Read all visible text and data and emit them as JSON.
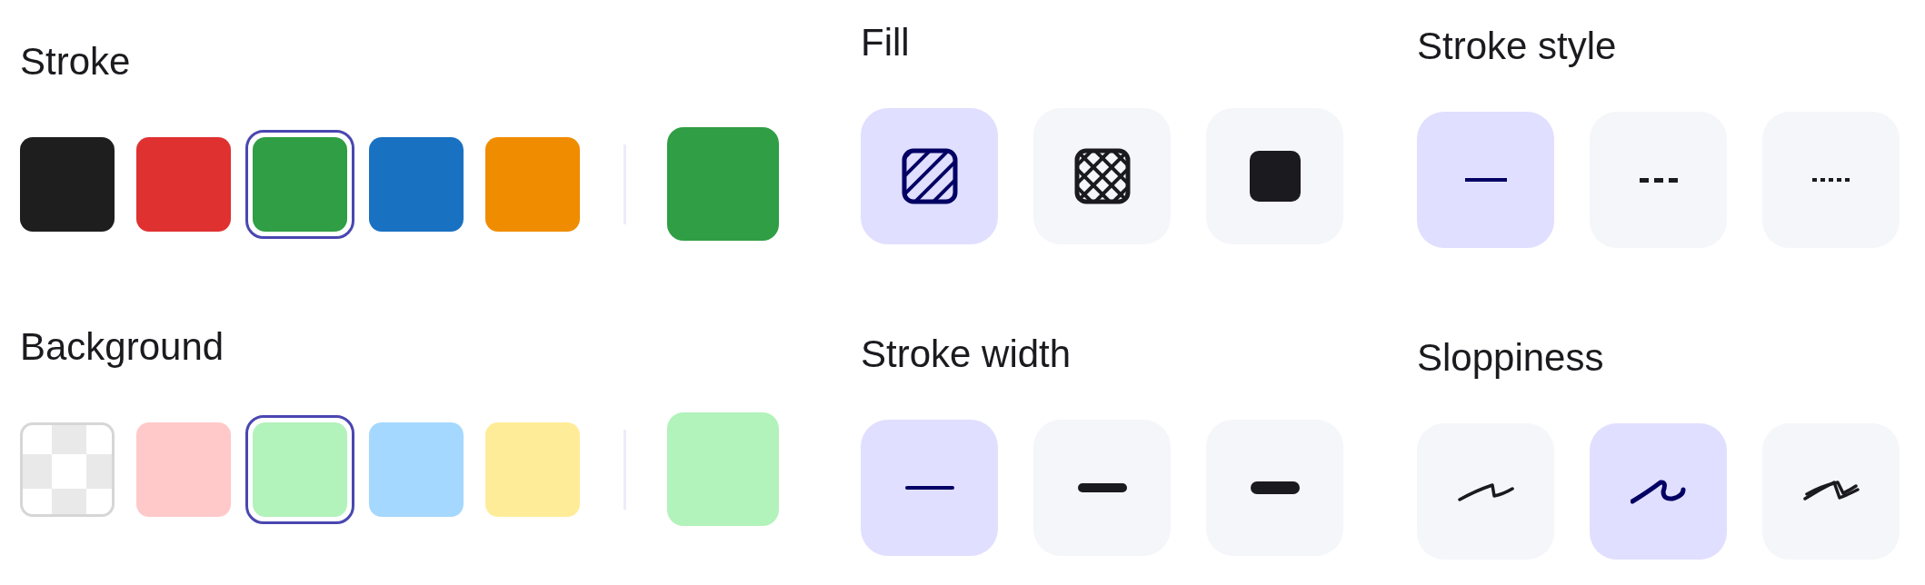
{
  "stroke": {
    "label": "Stroke",
    "swatches": [
      {
        "kind": "color",
        "color": "#1e1e1e",
        "selected": false
      },
      {
        "kind": "color",
        "color": "#e03131",
        "selected": false
      },
      {
        "kind": "color",
        "color": "#2f9e44",
        "selected": true
      },
      {
        "kind": "color",
        "color": "#1971c2",
        "selected": false
      },
      {
        "kind": "color",
        "color": "#f08c00",
        "selected": false
      }
    ],
    "current": {
      "color": "#2f9e44"
    }
  },
  "background": {
    "label": "Background",
    "swatches": [
      {
        "kind": "transparent",
        "selected": false
      },
      {
        "kind": "color",
        "color": "#ffc9c9",
        "selected": false
      },
      {
        "kind": "color",
        "color": "#b2f2bb",
        "selected": true
      },
      {
        "kind": "color",
        "color": "#a5d8ff",
        "selected": false
      },
      {
        "kind": "color",
        "color": "#ffec99",
        "selected": false
      }
    ],
    "current": {
      "color": "#b2f2bb"
    }
  },
  "fill": {
    "label": "Fill",
    "options": [
      {
        "kind": "hachure",
        "selected": true
      },
      {
        "kind": "cross-hatch",
        "selected": false
      },
      {
        "kind": "solid",
        "selected": false
      }
    ]
  },
  "stroke_width": {
    "label": "Stroke width",
    "options": [
      {
        "kind": "thin",
        "selected": true
      },
      {
        "kind": "bold",
        "selected": false
      },
      {
        "kind": "extra-bold",
        "selected": false
      }
    ]
  },
  "stroke_style": {
    "label": "Stroke style",
    "options": [
      {
        "kind": "solid",
        "selected": true
      },
      {
        "kind": "dashed",
        "selected": false
      },
      {
        "kind": "dotted",
        "selected": false
      }
    ]
  },
  "sloppiness": {
    "label": "Sloppiness",
    "options": [
      {
        "kind": "architect",
        "selected": false
      },
      {
        "kind": "artist",
        "selected": true
      },
      {
        "kind": "cartoonist",
        "selected": false
      }
    ]
  }
}
